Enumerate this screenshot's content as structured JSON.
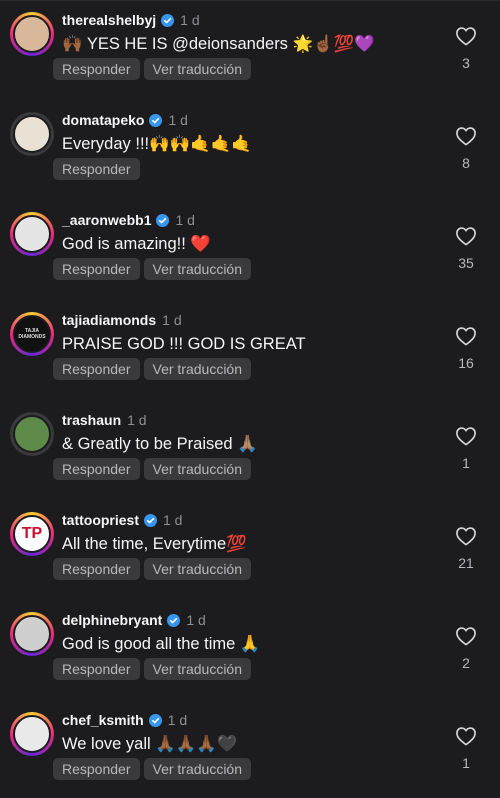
{
  "colors": {
    "background": "#1c1c1e",
    "pill_bg": "#3a3a3c",
    "verified": "#3797f0",
    "muted": "#8e8e93"
  },
  "comments": [
    {
      "username": "therealshelbyj",
      "verified": true,
      "time": "1 d",
      "text": "🙌🏾 YES HE IS @deionsanders 🌟☝🏾💯💜",
      "reply_label": "Responder",
      "translate_label": "Ver traducción",
      "likes": "3",
      "avatar_initials": "",
      "avatar_style": "ring"
    },
    {
      "username": "domatapeko",
      "verified": true,
      "time": "1 d",
      "text": "Everyday !!!🙌🙌🤙🤙🤙",
      "reply_label": "Responder",
      "likes": "8",
      "avatar_initials": "",
      "avatar_style": "plain"
    },
    {
      "username": "_aaronwebb1",
      "verified": true,
      "time": "1 d",
      "text": "God is amazing!! ❤️",
      "reply_label": "Responder",
      "translate_label": "Ver traducción",
      "likes": "35",
      "avatar_initials": "",
      "avatar_style": "ring"
    },
    {
      "username": "tajiadiamonds",
      "verified": false,
      "time": "1 d",
      "text": "PRAISE GOD !!! GOD IS GREAT",
      "reply_label": "Responder",
      "translate_label": "Ver traducción",
      "likes": "16",
      "avatar_initials": "TAJIA DIAMONDS",
      "avatar_style": "ring"
    },
    {
      "username": "trashaun",
      "verified": false,
      "time": "1 d",
      "text": "& Greatly to be Praised 🙏🏽",
      "reply_label": "Responder",
      "translate_label": "Ver traducción",
      "likes": "1",
      "avatar_initials": "",
      "avatar_style": "plain"
    },
    {
      "username": "tattoopriest",
      "verified": true,
      "time": "1 d",
      "text": "All the time, Everytime💯",
      "reply_label": "Responder",
      "translate_label": "Ver traducción",
      "likes": "21",
      "avatar_initials": "TP",
      "avatar_style": "ring"
    },
    {
      "username": "delphinebryant",
      "verified": true,
      "time": "1 d",
      "text": "God is good all the time 🙏",
      "reply_label": "Responder",
      "translate_label": "Ver traducción",
      "likes": "2",
      "avatar_initials": "",
      "avatar_style": "ring"
    },
    {
      "username": "chef_ksmith",
      "verified": true,
      "time": "1 d",
      "text": "We love yall 🙏🏾🙏🏾🙏🏾🖤",
      "reply_label": "Responder",
      "translate_label": "Ver traducción",
      "likes": "1",
      "avatar_initials": "",
      "avatar_style": "ring"
    }
  ]
}
